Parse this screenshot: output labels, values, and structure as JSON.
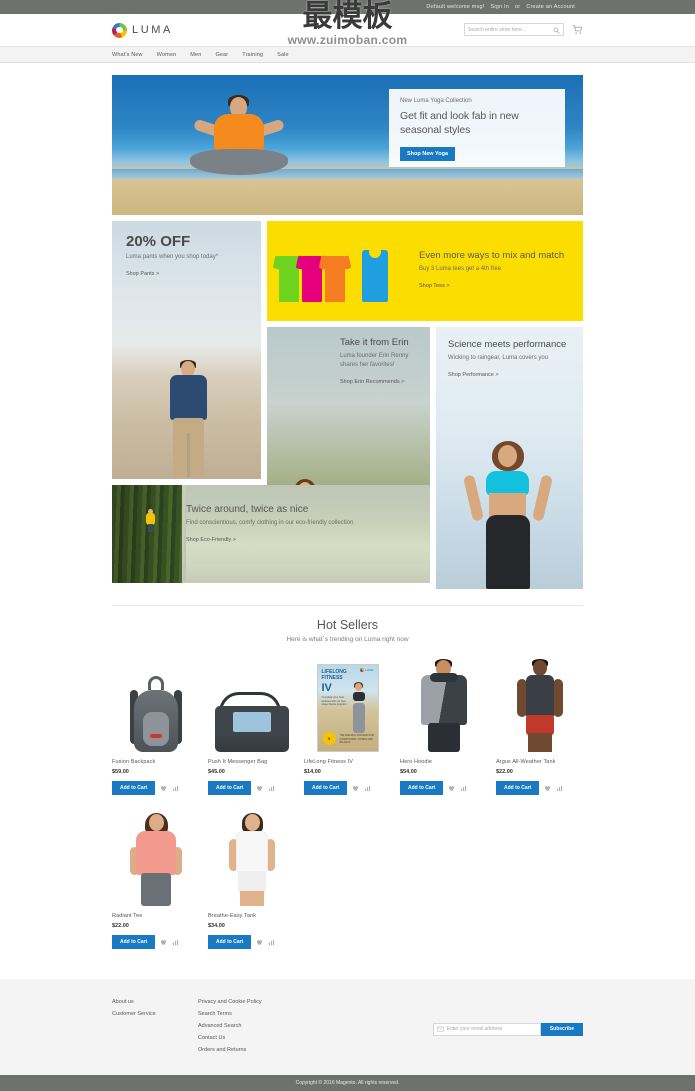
{
  "top_panel": {
    "welcome": "Default welcome msg!",
    "sign_in": "Sign In",
    "or": "or",
    "create_account": "Create an Account"
  },
  "header": {
    "logo_text": "LUMA",
    "logo_icon": "luma-ring-icon",
    "search_placeholder": "Search entire store here...",
    "search_value": "",
    "search_icon": "search-icon",
    "cart_icon": "shopping-cart-icon"
  },
  "nav": {
    "items": [
      {
        "label": "What's New"
      },
      {
        "label": "Women"
      },
      {
        "label": "Men"
      },
      {
        "label": "Gear"
      },
      {
        "label": "Training"
      },
      {
        "label": "Sale"
      }
    ]
  },
  "watermark": {
    "cn": "最模板",
    "url": "www.zuimoban.com"
  },
  "hero": {
    "eyebrow": "New Luma Yoga Collection",
    "title": "Get fit and look fab in new seasonal styles",
    "cta": "Shop New Yoga"
  },
  "promos": {
    "pants": {
      "big": "20% OFF",
      "desc": "Luma pants when you shop today*",
      "link": "Shop Pants  >"
    },
    "tees": {
      "title": "Even more ways to mix and match",
      "desc": "Buy 3 Luma tees get a 4th free",
      "link": "Shop Tees  >"
    },
    "erin": {
      "title": "Take it from Erin",
      "desc": "Luma founder Erin Renny shares her favorites!",
      "link": "Shop Erin Recommends  >"
    },
    "science": {
      "title": "Science meets performance",
      "desc": "Wicking to raingear, Luma covers you",
      "link": "Shop Performance  >"
    },
    "eco": {
      "title": "Twice around, twice as nice",
      "desc": "Find conscientious, comfy clothing in our eco-friendly collection",
      "link": "Shop Eco-Friendly  >"
    }
  },
  "hot_sellers": {
    "title": "Hot Sellers",
    "subtitle": "Here is what`s trending on Luma right now",
    "add_to_cart_label": "Add to Cart",
    "wishlist_icon": "heart-icon",
    "compare_icon": "compare-icon",
    "products": [
      {
        "name": "Fusion Backpack",
        "price": "$59.00"
      },
      {
        "name": "Push It Messenger Bag",
        "price": "$45.00"
      },
      {
        "name": "LifeLong Fitness IV",
        "price": "$14.00"
      },
      {
        "name": "Hero Hoodie",
        "price": "$54.00"
      },
      {
        "name": "Argus All-Weather Tank",
        "price": "$22.00"
      },
      {
        "name": "Radiant Tee",
        "price": "$22.00"
      },
      {
        "name": "Breathe-Easy Tank",
        "price": "$34.00"
      }
    ],
    "dvd_art": {
      "line1": "LIFELONG",
      "line2": "FITNESS",
      "numeral": "IV",
      "blurb": "Complete your best workout with our four-stage fitness program.",
      "badge": "5",
      "footer": "THE LIFELONG PROGRAM FOR CONDITIONING, FITNESS AND BALANCE",
      "brand": "LUMA"
    }
  },
  "footer": {
    "col1": [
      {
        "label": "About us"
      },
      {
        "label": "Customer Service"
      }
    ],
    "col2": [
      {
        "label": "Privacy and Cookie Policy"
      },
      {
        "label": "Search Terms"
      },
      {
        "label": "Advanced Search"
      },
      {
        "label": "Contact Us"
      },
      {
        "label": "Orders and Returns"
      }
    ],
    "newsletter": {
      "placeholder": "Enter your email address",
      "value": "",
      "envelope_icon": "envelope-icon",
      "button": "Subscribe"
    },
    "copyright": "Copyright © 2016 Magento. All rights reserved."
  },
  "colors": {
    "accent": "#1979c3",
    "top_bar": "#6e716e",
    "yellow_promo": "#fcdd00",
    "hero_blue": "#2e86c6"
  }
}
